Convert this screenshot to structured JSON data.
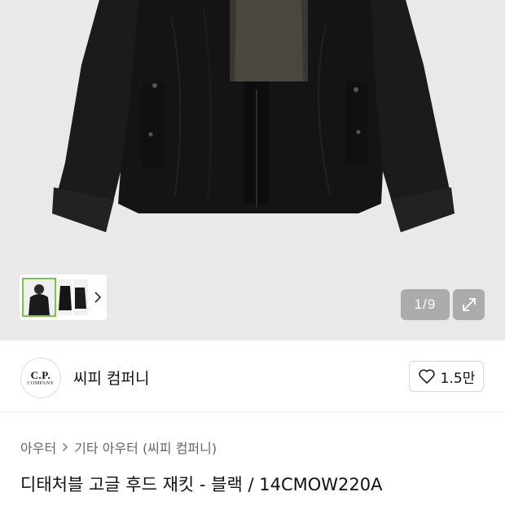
{
  "gallery": {
    "counter": "1/9",
    "current_image": 1,
    "total_images": 9,
    "selected_thumb_border": "#7ec24c"
  },
  "brand": {
    "logo_text_main": "C.P.",
    "logo_text_sub": "COMPANY",
    "name": "씨피 컴퍼니",
    "like_count": "1.5만"
  },
  "breadcrumb": {
    "items": [
      "아우터",
      "기타 아우터 (씨피 컴퍼니)"
    ]
  },
  "product": {
    "title": "디태처블 고글 후드 재킷 - 블랙 / 14CMOW220A"
  },
  "icons": {
    "thumb_next": "chevron-right-icon",
    "expand": "expand-arrows-icon",
    "like": "heart-outline-icon",
    "breadcrumb_sep": "chevron-right-icon"
  }
}
